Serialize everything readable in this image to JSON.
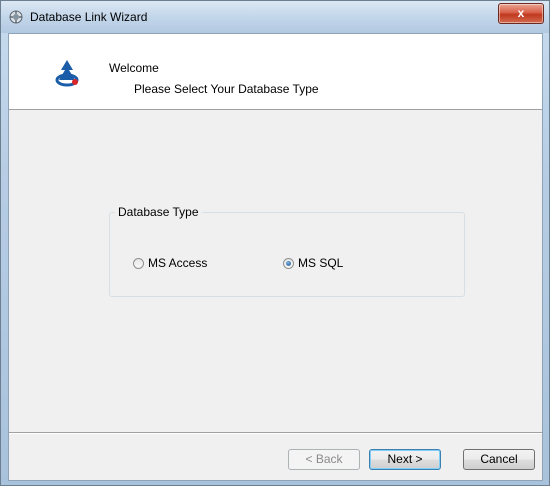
{
  "window": {
    "title": "Database Link Wizard",
    "close_label": "x"
  },
  "header": {
    "welcome": "Welcome",
    "subtitle": "Please Select Your Database Type"
  },
  "database_type": {
    "legend": "Database Type",
    "options": [
      {
        "label": "MS Access",
        "selected": false
      },
      {
        "label": "MS SQL",
        "selected": true
      }
    ]
  },
  "buttons": {
    "back": "< Back",
    "next": "Next >",
    "cancel": "Cancel"
  },
  "colors": {
    "close_button": "#c0391f",
    "client_bg": "#f0f0f0",
    "header_bg": "#ffffff"
  }
}
